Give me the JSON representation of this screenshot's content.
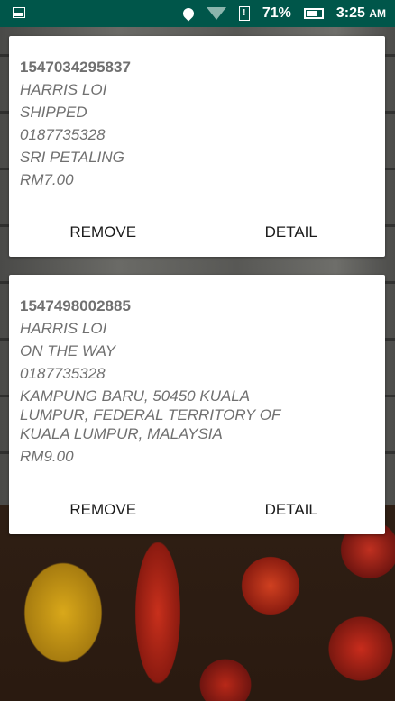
{
  "status_bar": {
    "battery": "71%",
    "time": "3:25",
    "ampm": "AM",
    "icons": [
      "image-icon",
      "location-icon",
      "wifi-icon",
      "sim-alert-icon",
      "battery-icon"
    ]
  },
  "orders": [
    {
      "id": "1547034295837",
      "name": "HARRIS LOI",
      "status": "SHIPPED",
      "phone": "0187735328",
      "address": "SRI PETALING",
      "amount": "RM7.00",
      "remove": "REMOVE",
      "detail": "DETAIL"
    },
    {
      "id": "1547498002885",
      "name": "HARRIS LOI",
      "status": "ON THE WAY",
      "phone": "0187735328",
      "address": "KAMPUNG BARU, 50450 KUALA LUMPUR, FEDERAL TERRITORY OF KUALA LUMPUR, MALAYSIA",
      "amount": "RM9.00",
      "remove": "REMOVE",
      "detail": "DETAIL"
    }
  ]
}
